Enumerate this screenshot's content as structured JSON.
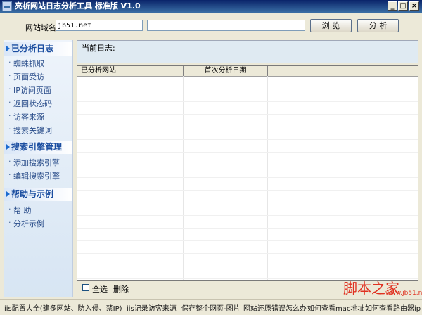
{
  "window": {
    "title": "亮析网站日志分析工具 标准版 V1.0",
    "minimize_glyph": "_",
    "maximize_glyph": "□",
    "close_glyph": "×"
  },
  "toolbar": {
    "domain_label": "网站域名:",
    "domain_value": "jb51.net",
    "path_value": "",
    "browse_label": "浏 览",
    "analyze_label": "分 析"
  },
  "sidebar": {
    "sections": [
      {
        "title": "已分析日志",
        "items": [
          "蜘蛛抓取",
          "页面受访",
          "IP访问页面",
          "返回状态码",
          "访客来源",
          "搜索关键词"
        ]
      },
      {
        "title": "搜索引擎管理",
        "items": [
          "添加搜索引擎",
          "编辑搜索引擎"
        ]
      },
      {
        "title": "帮助与示例",
        "items": [
          "帮 助",
          "分析示例"
        ]
      }
    ]
  },
  "main": {
    "current_log_label": "当前日志:",
    "table": {
      "columns": [
        "已分析网站",
        "首次分析日期",
        ""
      ],
      "rows": []
    },
    "select_all_label": "全选",
    "delete_label": "删除"
  },
  "bottom_links": [
    "iis配置大全(建多网站、防入侵、禁IP)",
    "iis记录访客来源",
    "保存整个网页-图片",
    "网站还原错误怎么办",
    "如何查看mac地址",
    "如何查看路由器ip"
  ],
  "watermark": {
    "text": "脚本之家",
    "url": "www.jb51.net"
  },
  "colors": {
    "titlebar": "#0a246a",
    "section_title": "#1b4ea0",
    "watermark": "#e03020"
  }
}
